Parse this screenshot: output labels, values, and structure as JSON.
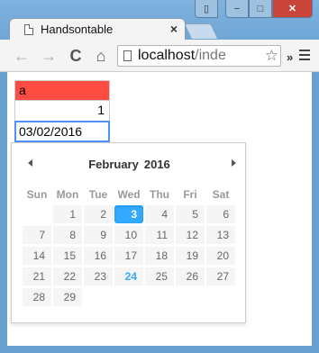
{
  "window": {
    "tab_title": "Handsontable",
    "tab_close": "×",
    "controls": {
      "user": "▯",
      "minimize": "−",
      "maximize": "□",
      "close": "✕"
    }
  },
  "toolbar": {
    "back_icon": "←",
    "forward_icon": "→",
    "reload_icon": "C",
    "home_icon": "⌂",
    "url_main": "localhost",
    "url_tail": "/inde",
    "star_icon": "☆",
    "overflow_chevron": "»"
  },
  "grid": {
    "cells": [
      "a",
      "1",
      "03/02/2016"
    ],
    "highlight_color": "#ff4c42",
    "active_border_color": "#5292f7"
  },
  "datepicker": {
    "month": "February",
    "year": "2016",
    "weekdays": [
      "Sun",
      "Mon",
      "Tue",
      "Wed",
      "Thu",
      "Fri",
      "Sat"
    ],
    "weeks": [
      [
        "",
        "1",
        "2",
        "3",
        "4",
        "5",
        "6"
      ],
      [
        "7",
        "8",
        "9",
        "10",
        "11",
        "12",
        "13"
      ],
      [
        "14",
        "15",
        "16",
        "17",
        "18",
        "19",
        "20"
      ],
      [
        "21",
        "22",
        "23",
        "24",
        "25",
        "26",
        "27"
      ],
      [
        "28",
        "29",
        "",
        "",
        "",
        "",
        ""
      ]
    ],
    "selected_day": "3",
    "today_day": "24",
    "accent_color": "#33aaff"
  }
}
